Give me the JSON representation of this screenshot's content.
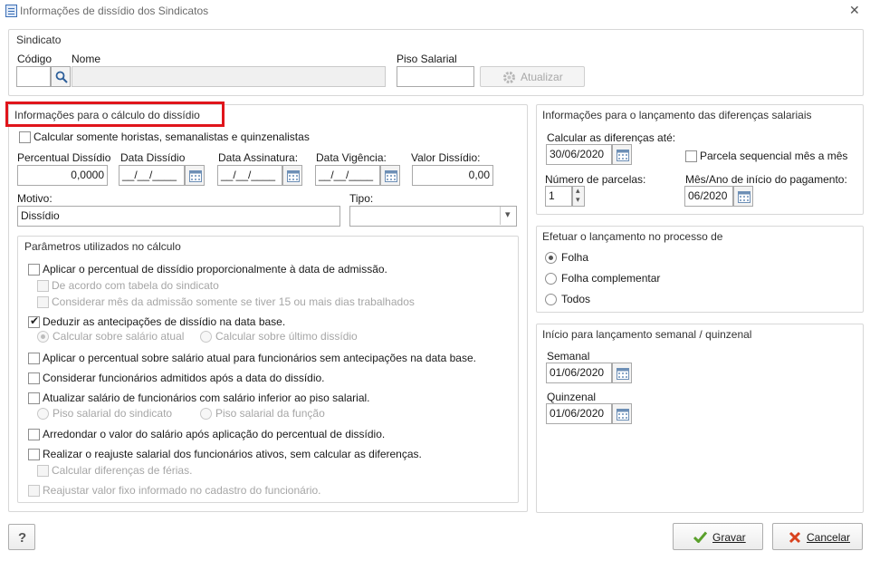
{
  "window": {
    "title": "Informações de dissídio dos Sindicatos"
  },
  "sindicato": {
    "title": "Sindicato",
    "codigo_label": "Código",
    "codigo_value": "",
    "nome_label": "Nome",
    "nome_value": "",
    "piso_label": "Piso Salarial",
    "piso_value": "",
    "atualizar_label": "Atualizar"
  },
  "calculo": {
    "title": "Informações para o cálculo do dissídio",
    "somente_horistas_label": "Calcular somente horistas, semanalistas e quinzenalistas",
    "percentual_label": "Percentual Dissídio",
    "percentual_value": "0,0000",
    "data_dissidio_label": "Data Dissídio",
    "data_dissidio_value": "__/__/____",
    "data_assinatura_label": "Data Assinatura:",
    "data_assinatura_value": "__/__/____",
    "data_vigencia_label": "Data Vigência:",
    "data_vigencia_value": "__/__/____",
    "valor_label": "Valor Dissídio:",
    "valor_value": "0,00",
    "motivo_label": "Motivo:",
    "motivo_value": "Dissídio",
    "tipo_label": "Tipo:",
    "tipo_value": ""
  },
  "parametros": {
    "title": "Parâmetros utilizados no cálculo",
    "p1": "Aplicar o percentual de dissídio proporcionalmente à data de admissão.",
    "p1a": "De acordo com tabela do sindicato",
    "p1b": "Considerar mês da admissão somente se tiver 15 ou mais dias trabalhados",
    "p2": "Deduzir as antecipações de dissídio na data base.",
    "p2a": "Calcular sobre salário atual",
    "p2b": "Calcular sobre último dissídio",
    "p3": "Aplicar o percentual sobre salário atual para funcionários sem antecipações na data base.",
    "p4": "Considerar funcionários admitidos após a data do dissídio.",
    "p5": "Atualizar salário de funcionários com salário inferior ao piso salarial.",
    "p5a": "Piso salarial do sindicato",
    "p5b": "Piso salarial da função",
    "p6": "Arredondar o valor do salário após aplicação do percentual de dissídio.",
    "p7": "Realizar o reajuste salarial dos funcionários ativos, sem calcular as diferenças.",
    "p7a": "Calcular diferenças de férias.",
    "p8": "Reajustar valor fixo informado no cadastro do funcionário."
  },
  "lancamento": {
    "title": "Informações para o lançamento das diferenças salariais",
    "calcular_ate_label": "Calcular as diferenças até:",
    "calcular_ate_value": "30/06/2020",
    "parcela_seq_label": "Parcela sequencial mês a mês",
    "num_parcelas_label": "Número de parcelas:",
    "num_parcelas_value": "1",
    "mes_ano_label": "Mês/Ano de início do pagamento:",
    "mes_ano_value": "06/2020"
  },
  "processo": {
    "title": "Efetuar o lançamento no processo de",
    "folha": "Folha",
    "folha_complementar": "Folha complementar",
    "todos": "Todos"
  },
  "semanal": {
    "title": "Início para lançamento semanal / quinzenal",
    "semanal_label": "Semanal",
    "semanal_value": "01/06/2020",
    "quinzenal_label": "Quinzenal",
    "quinzenal_value": "01/06/2020"
  },
  "footer": {
    "help_label": "?",
    "gravar_label": "Gravar",
    "cancelar_label": "Cancelar"
  },
  "colors": {
    "highlight": "#e0151b",
    "ok_green": "#5aa02c",
    "cancel_red": "#d9421e"
  },
  "icons": [
    "window-icon",
    "close-icon",
    "search-icon",
    "gear-icon",
    "calendar-icon",
    "check-icon",
    "x-icon",
    "help-icon"
  ]
}
